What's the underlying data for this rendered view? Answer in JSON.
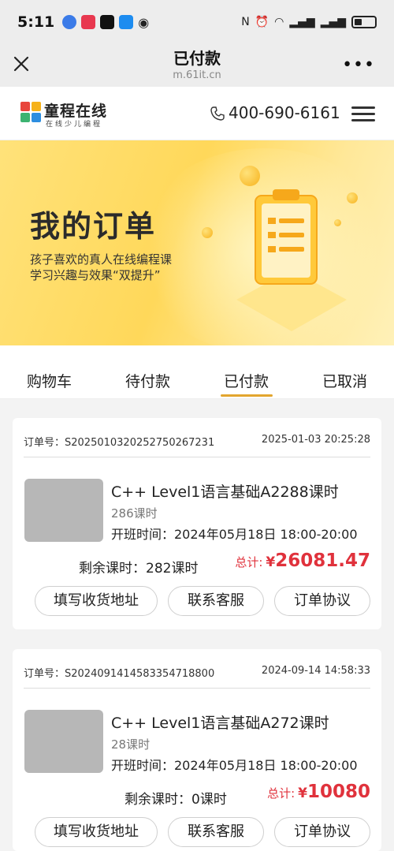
{
  "status_bar": {
    "time": "5:11"
  },
  "title_bar": {
    "title": "已付款",
    "url": "m.61it.cn"
  },
  "site_header": {
    "logo_name": "童程在线",
    "logo_sub": "在线少儿编程",
    "phone": "400-690-6161"
  },
  "banner": {
    "title": "我的订单",
    "line1": "孩子喜欢的真人在线编程课",
    "line2": "学习兴趣与效果“双提升”"
  },
  "tabs": [
    {
      "label": "购物车",
      "active": false
    },
    {
      "label": "待付款",
      "active": false
    },
    {
      "label": "已付款",
      "active": true
    },
    {
      "label": "已取消",
      "active": false
    }
  ],
  "orders": [
    {
      "order_no": "订单号：S20250103202527502672 31",
      "order_time": "2025-01-03 20:25:28",
      "name": "C++ Level1语言基础A2288课时",
      "hours": "286课时",
      "start_time": "开班时间：2024年05月18日 18:00-20:00",
      "remaining": "剩余课时：282课时",
      "total_label": "总计:",
      "currency": "¥",
      "amount": "26081.47",
      "buttons": [
        "填写收货地址",
        "联系客服",
        "订单协议"
      ]
    },
    {
      "order_no": "订单号：S20240914145833547188 00",
      "order_time": "2024-09-14 14:58:33",
      "name": "C++ Level1语言基础A272课时",
      "hours": "28课时",
      "start_time": "开班时间：2024年05月18日 18:00-20:00",
      "remaining": "剩余课时：0课时",
      "total_label": "总计:",
      "currency": "¥",
      "amount": "10080",
      "buttons": [
        "填写收货地址",
        "联系客服",
        "订单协议"
      ]
    }
  ],
  "colors": {
    "accent": "#e2a52e",
    "price": "#e0323c",
    "banner": "#ffd85a"
  }
}
